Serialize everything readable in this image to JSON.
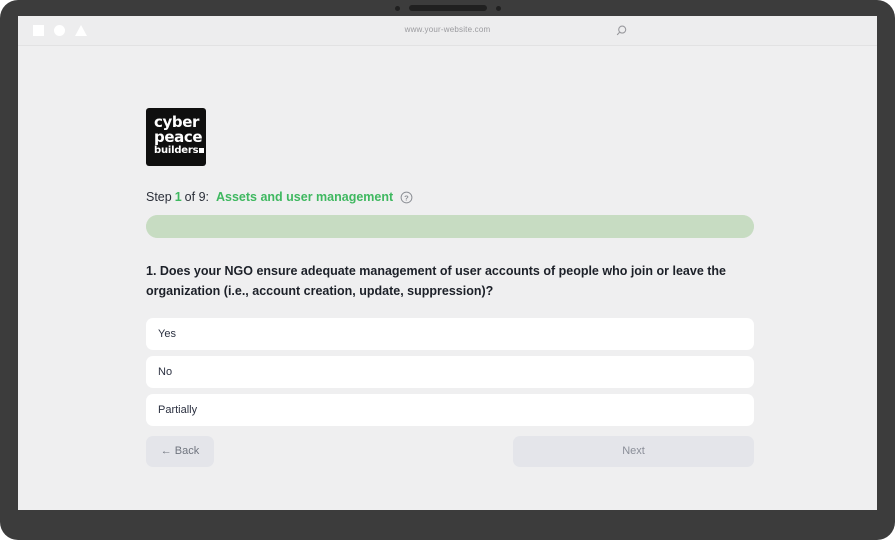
{
  "device": {
    "camera_icon": "camera-dot",
    "speaker_icon": "speaker-bar"
  },
  "browser": {
    "shape_buttons": [
      {
        "icon": "square-icon"
      },
      {
        "icon": "circle-icon"
      },
      {
        "icon": "triangle-icon"
      }
    ],
    "url": "www.your-website.com",
    "search_icon": "search-icon"
  },
  "brand": {
    "logo_line1": "cyber",
    "logo_line2": "peace",
    "logo_line3": "builders",
    "logo_alt": "cyberpeace builders logo"
  },
  "wizard": {
    "step_word": "Step",
    "step_current": "1",
    "step_of": "of 9:",
    "step_title": "Assets and user management",
    "help_icon": "question-mark-circle-icon",
    "progress_percent": 100,
    "accent_color": "#3fb860",
    "progress_color": "#c7dcc2"
  },
  "question": {
    "text": "1. Does your NGO ensure adequate management of user accounts of people who join or leave the organization (i.e., account creation, update, suppression)?",
    "options": [
      {
        "label": "Yes"
      },
      {
        "label": "No"
      },
      {
        "label": "Partially"
      }
    ]
  },
  "actions": {
    "back_label": "← Back",
    "next_label": "Next"
  }
}
